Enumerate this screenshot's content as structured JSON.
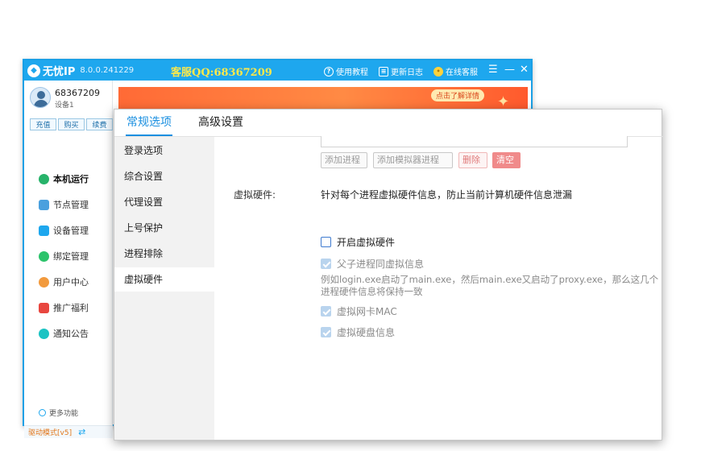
{
  "main_window": {
    "app_name": "无忧IP",
    "version": "8.0.0.241229",
    "service_qq": "客服QQ:68367209",
    "links": {
      "tutorial": "使用教程",
      "changelog": "更新日志",
      "support": "在线客服"
    },
    "controls": {
      "menu": "☰",
      "minimize": "—",
      "close": "✕"
    },
    "user": {
      "id": "68367209",
      "device": "设备1"
    },
    "account_buttons": {
      "recharge": "充值",
      "buy": "购买",
      "renew": "续费"
    },
    "nav": [
      {
        "label": "本机运行",
        "icon": "play-icon"
      },
      {
        "label": "节点管理",
        "icon": "nodes-icon"
      },
      {
        "label": "设备管理",
        "icon": "device-icon"
      },
      {
        "label": "绑定管理",
        "icon": "bind-icon"
      },
      {
        "label": "用户中心",
        "icon": "user-icon"
      },
      {
        "label": "推广福利",
        "icon": "gift-icon"
      },
      {
        "label": "通知公告",
        "icon": "bell-icon"
      }
    ],
    "more_features": "更多功能",
    "drive_mode": "驱动模式[v5]",
    "ad_tag": "点击了解详情"
  },
  "settings": {
    "tabs": {
      "general": "常规选项",
      "advanced": "高级设置"
    },
    "sidebar": [
      "登录选项",
      "综合设置",
      "代理设置",
      "上号保护",
      "进程排除",
      "虚拟硬件"
    ],
    "process_buttons": {
      "add_process": "添加进程",
      "add_emulator": "添加模拟器进程",
      "delete": "删除",
      "clear": "清空"
    },
    "virtual_hardware": {
      "label": "虚拟硬件:",
      "description": "针对每个进程虚拟硬件信息，防止当前计算机硬件信息泄漏",
      "enable": {
        "label": "开启虚拟硬件",
        "checked": false
      },
      "child_process": {
        "label": "父子进程同虚拟信息",
        "checked": true
      },
      "child_note": "例如login.exe启动了main.exe，然后main.exe又启动了proxy.exe，那么这几个进程硬件信息将保持一致",
      "nic_mac": {
        "label": "虚拟网卡MAC",
        "checked": true
      },
      "disk": {
        "label": "虚拟硬盘信息",
        "checked": true
      }
    }
  },
  "colors": {
    "brand": "#1ea7ee",
    "tab_active": "#1a8fe0",
    "qq_text": "#ffe94a",
    "danger": "#f08a8a"
  }
}
